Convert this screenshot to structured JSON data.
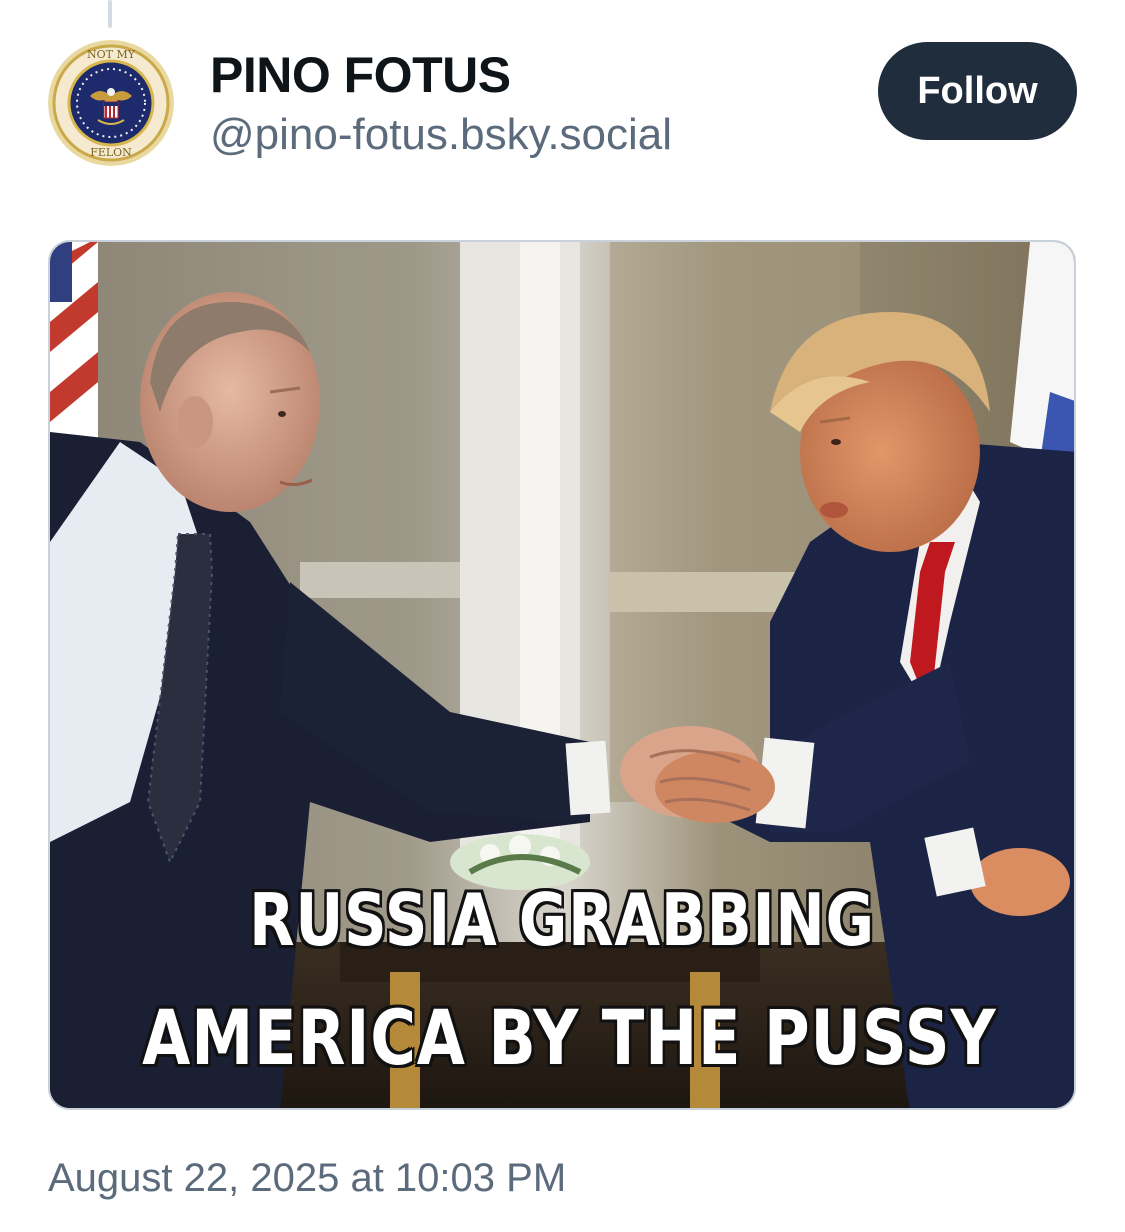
{
  "post": {
    "author": {
      "display_name": "PINO FOTUS",
      "handle": "@pino-fotus.bsky.social",
      "avatar": {
        "icon": "presidential-seal-icon",
        "text_top": "NOT MY",
        "text_bottom": "FELON"
      }
    },
    "follow_label": "Follow",
    "image": {
      "caption_line_1": "RUSSIA GRABBING",
      "caption_line_2": "AMERICA BY THE PUSSY"
    },
    "timestamp": "August 22, 2025 at 10:03 PM"
  },
  "colors": {
    "follow_button_bg": "#1f2d3d",
    "handle_text": "#5b6b7c",
    "name_text": "#0f1419"
  }
}
